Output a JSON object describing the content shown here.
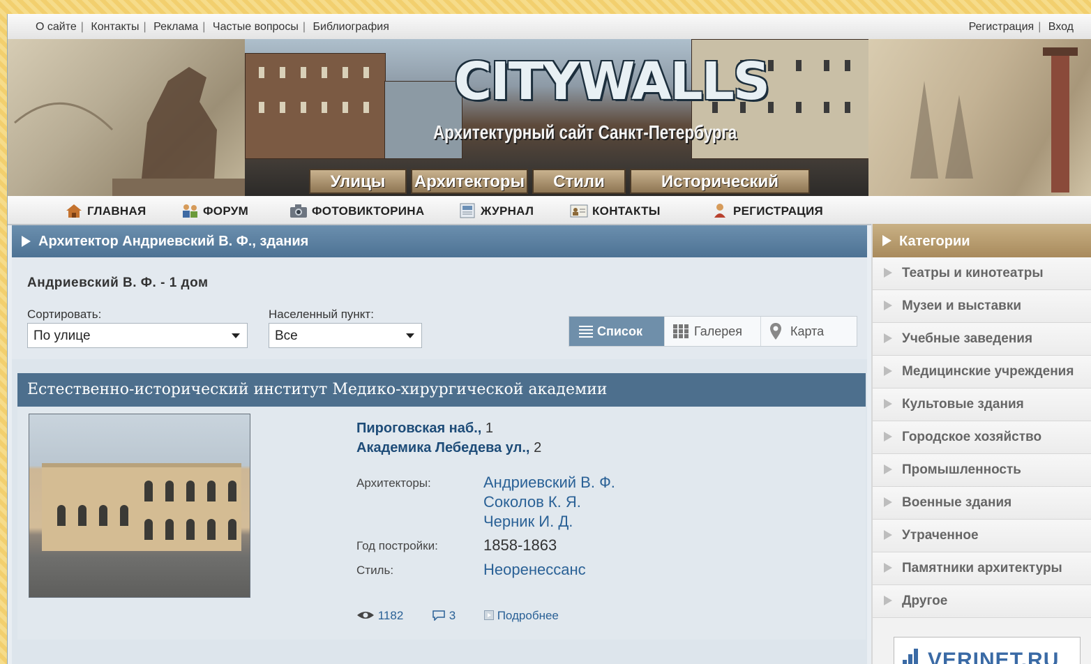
{
  "toplinks": {
    "left": [
      "О сайте",
      "Контакты",
      "Реклама",
      "Частые вопросы",
      "Библиография"
    ],
    "right": [
      "Регистрация",
      "Вход"
    ]
  },
  "banner": {
    "logo": "CITYWALLS",
    "tagline": "Архитектурный сайт Санкт-Петербурга",
    "nav": [
      "Улицы",
      "Архитекторы",
      "Стили",
      "Исторический период"
    ]
  },
  "mainnav": [
    {
      "label": "ГЛАВНАЯ",
      "icon": "home-icon"
    },
    {
      "label": "ФОРУМ",
      "icon": "forum-users-icon"
    },
    {
      "label": "ФОТОВИКТОРИНА",
      "icon": "camera-icon"
    },
    {
      "label": "ЖУРНАЛ",
      "icon": "journal-icon"
    },
    {
      "label": "КОНТАКТЫ",
      "icon": "contact-card-icon"
    },
    {
      "label": "РЕГИСТРАЦИЯ",
      "icon": "person-icon"
    }
  ],
  "content": {
    "title": "Архитектор Андриевский В. Ф., здания",
    "count_text": "Андриевский В. Ф. - 1 дом",
    "sort": {
      "label": "Сортировать:",
      "value": "По улице"
    },
    "locality": {
      "label": "Населенный пункт:",
      "value": "Все"
    },
    "views": [
      {
        "label": "Список",
        "icon": "list-icon",
        "active": true
      },
      {
        "label": "Галерея",
        "icon": "grid-icon",
        "active": false
      },
      {
        "label": "Карта",
        "icon": "map-pin-icon",
        "active": false
      }
    ]
  },
  "building": {
    "name": "Естественно-исторический институт Медико-хирургической академии",
    "addresses": [
      {
        "street": "Пироговская наб.,",
        "number": "1"
      },
      {
        "street": "Академика Лебедева ул.,",
        "number": "2"
      }
    ],
    "architects_label": "Архитекторы:",
    "architects": [
      "Андриевский В. Ф.",
      "Соколов К. Я.",
      "Черник И. Д."
    ],
    "year_label": "Год постройки:",
    "year": "1858-1863",
    "style_label": "Стиль:",
    "style": "Неоренессанс",
    "view_count": "1182",
    "comments": "3",
    "more": "Подробнее"
  },
  "sidebar": {
    "title": "Категории",
    "items": [
      "Театры и кинотеатры",
      "Музеи и выставки",
      "Учебные заведения",
      "Медицинские учреждения",
      "Культовые здания",
      "Городское хозяйство",
      "Промышленность",
      "Военные здания",
      "Утраченное",
      "Памятники архитектуры",
      "Другое"
    ],
    "banner_text": "VERINET.RU"
  }
}
